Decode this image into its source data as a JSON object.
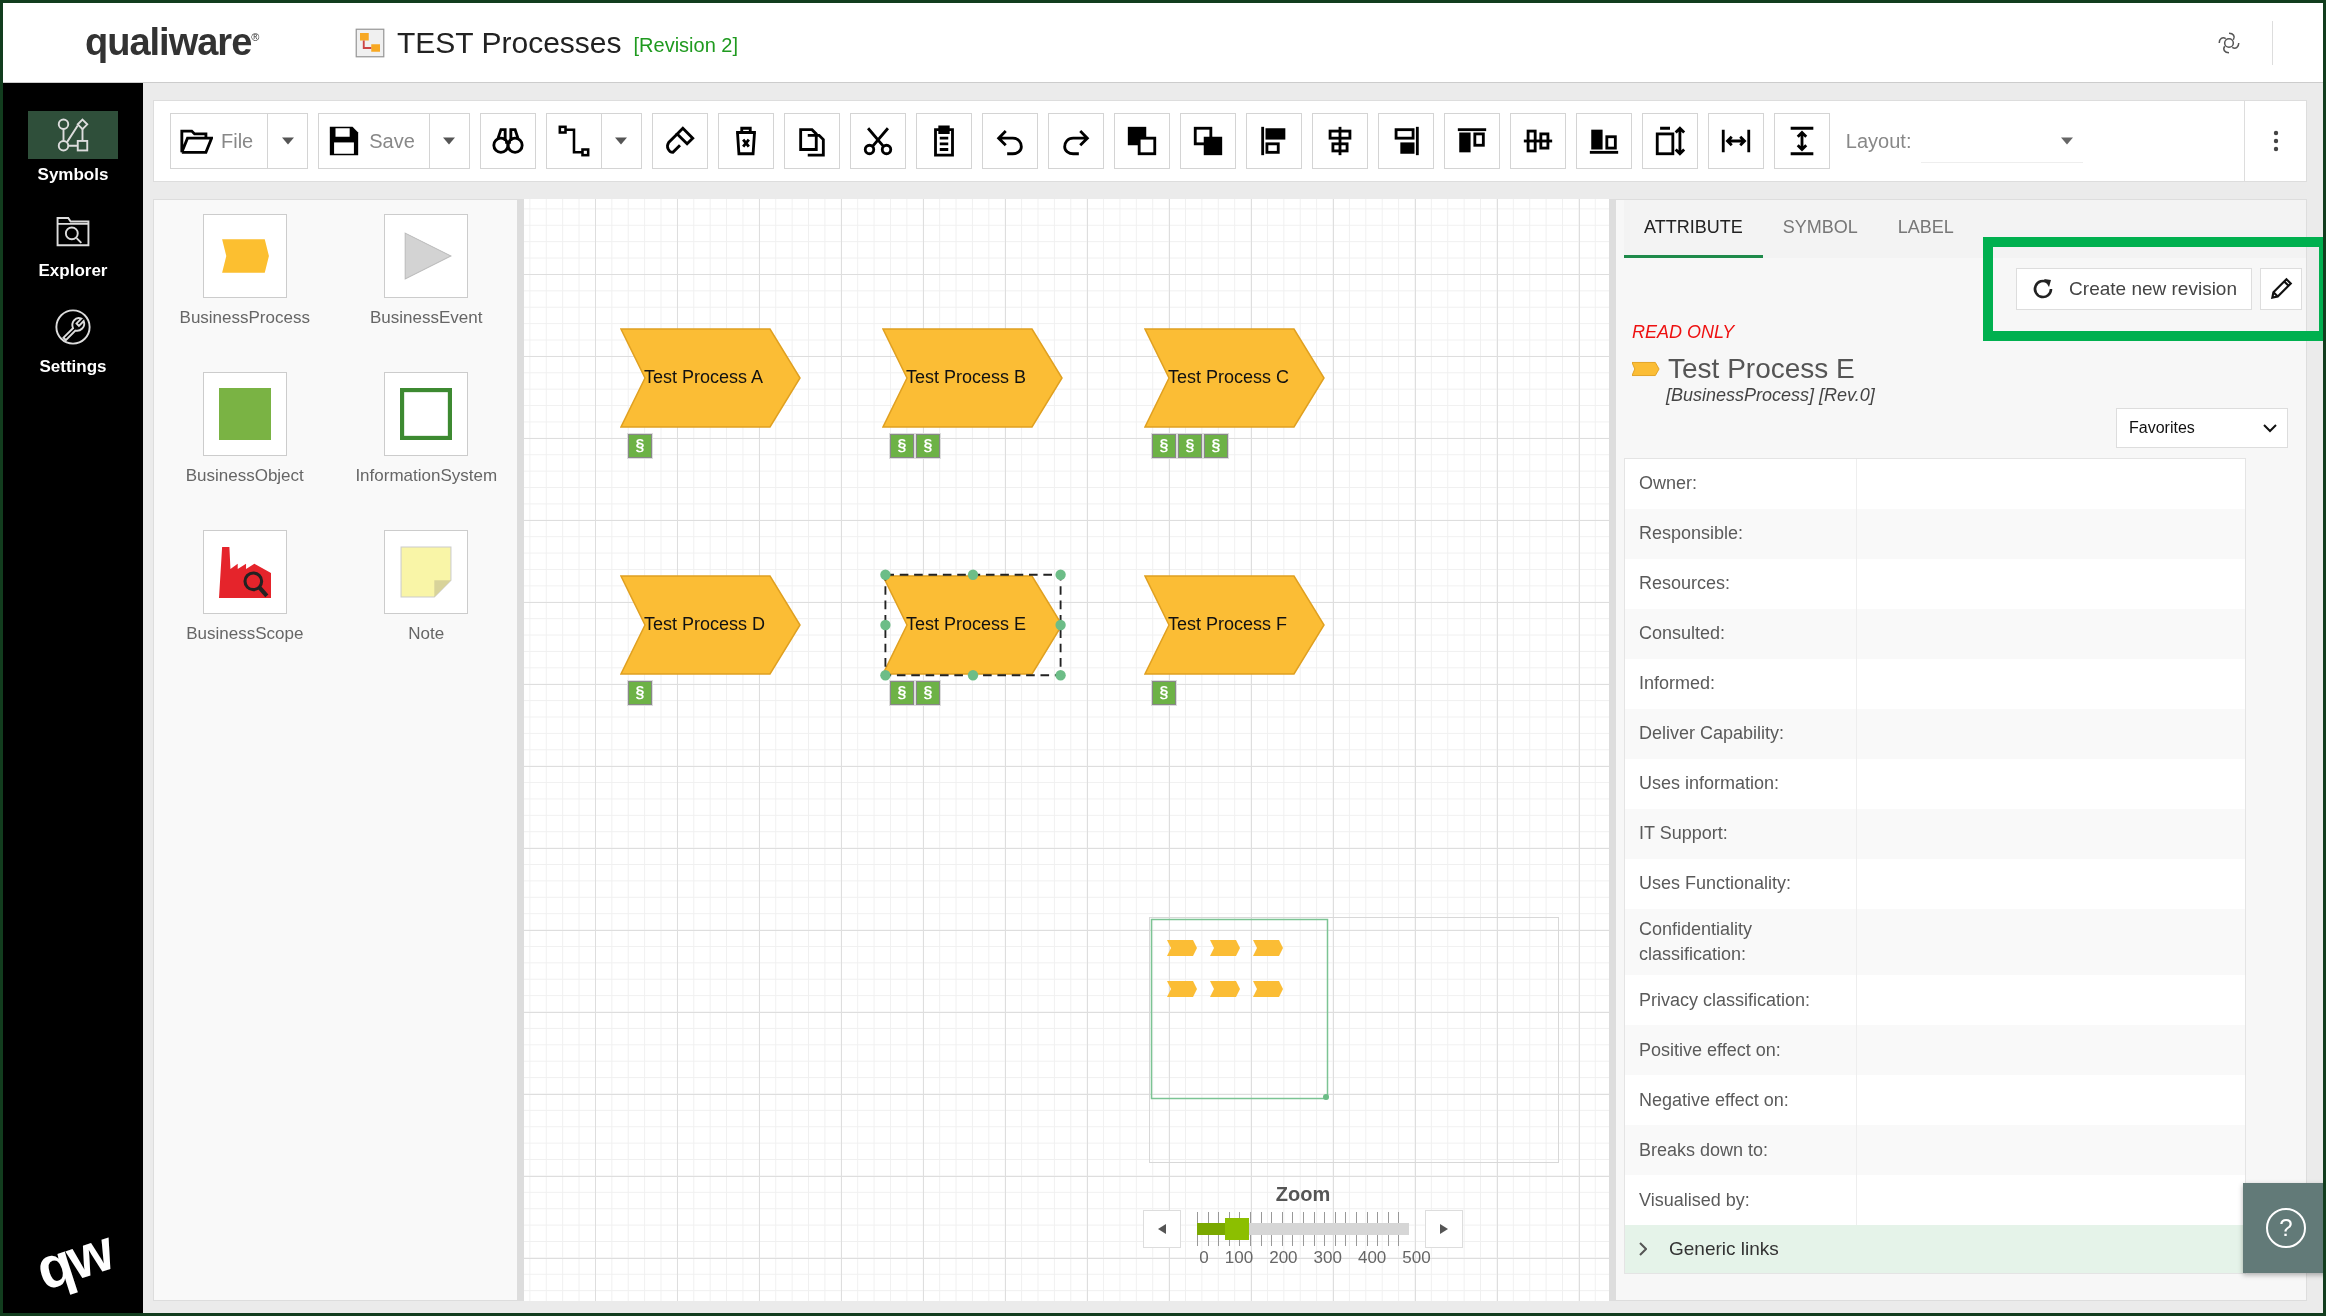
{
  "header": {
    "logo": "qualiware$^{®}$",
    "title": "TEST Processes",
    "revision": "[Revision 2]"
  },
  "nav": [
    {
      "label": "Symbols",
      "selected": true
    },
    {
      "label": "Explorer",
      "selected": false
    },
    {
      "label": "Settings",
      "selected": false
    }
  ],
  "nav_logo": "qw",
  "toolbar": {
    "file": "File",
    "save": "Save",
    "layout_label": "Layout:"
  },
  "palette": [
    {
      "label": "BusinessProcess",
      "kind": "process"
    },
    {
      "label": "BusinessEvent",
      "kind": "event"
    },
    {
      "label": "BusinessObject",
      "kind": "object"
    },
    {
      "label": "InformationSystem",
      "kind": "system"
    },
    {
      "label": "BusinessScope",
      "kind": "scope"
    },
    {
      "label": "Note",
      "kind": "note"
    }
  ],
  "processes": [
    {
      "label": "Test Process A",
      "badges": [
        "§"
      ],
      "selected": false
    },
    {
      "label": "Test Process B",
      "badges": [
        "§",
        "§"
      ],
      "selected": false
    },
    {
      "label": "Test Process C",
      "badges": [
        "§",
        "§",
        "§"
      ],
      "selected": false
    },
    {
      "label": "Test Process D",
      "badges": [
        "§"
      ],
      "selected": false
    },
    {
      "label": "Test Process E",
      "badges": [
        "§",
        "§"
      ],
      "selected": true
    },
    {
      "label": "Test Process F",
      "badges": [
        "§"
      ],
      "selected": false
    }
  ],
  "zoom": {
    "label": "Zoom",
    "level": 0.19,
    "ticks": [
      "0",
      "100",
      "200",
      "300",
      "400",
      "500"
    ]
  },
  "tabs": [
    {
      "label": "ATTRIBUTE",
      "selected": true
    },
    {
      "label": "SYMBOL",
      "selected": false
    },
    {
      "label": "LABEL",
      "selected": false
    }
  ],
  "create_revision_button": "Create new revision",
  "status": "READ ONLY",
  "object": {
    "name": "Test Process E",
    "type": "[BusinessProcess] [Rev.0]"
  },
  "view_select": "Favorites",
  "attributes": [
    "Owner:",
    "Responsible:",
    "Resources:",
    "Consulted:",
    "Informed:",
    "Deliver Capability:",
    "Uses information:",
    "IT Support:",
    "Uses Functionality:",
    "Confidentiality classification:",
    "Privacy classification:",
    "Positive effect on:",
    "Negative effect on:",
    "Breaks down to:",
    "Visualised by:"
  ],
  "generic_links": {
    "label": "Generic links",
    "expanded": false
  },
  "help_button": "?"
}
